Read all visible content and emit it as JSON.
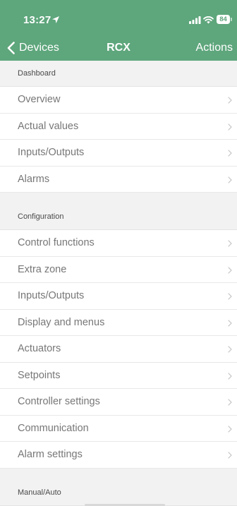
{
  "status_bar": {
    "time": "13:27",
    "battery": "84",
    "icons": [
      "location-arrow-icon",
      "cellular-signal-icon",
      "wifi-icon",
      "battery-icon"
    ]
  },
  "nav": {
    "back_label": "Devices",
    "title": "RCX",
    "actions_label": "Actions",
    "back_icon": "chevron-left-icon"
  },
  "colors": {
    "header": "#5ea67c",
    "background": "#f2f2f2",
    "row_background": "#ffffff",
    "row_text": "#777777",
    "chevron": "#c4c4c4"
  },
  "sections": [
    {
      "title": "Dashboard",
      "items": [
        {
          "label": "Overview"
        },
        {
          "label": "Actual values"
        },
        {
          "label": "Inputs/Outputs"
        },
        {
          "label": "Alarms"
        }
      ]
    },
    {
      "title": "Configuration",
      "items": [
        {
          "label": "Control functions"
        },
        {
          "label": "Extra zone"
        },
        {
          "label": "Inputs/Outputs"
        },
        {
          "label": "Display and menus"
        },
        {
          "label": "Actuators"
        },
        {
          "label": "Setpoints"
        },
        {
          "label": "Controller settings"
        },
        {
          "label": "Communication"
        },
        {
          "label": "Alarm settings"
        }
      ]
    },
    {
      "title": "Manual/Auto",
      "items": []
    }
  ]
}
